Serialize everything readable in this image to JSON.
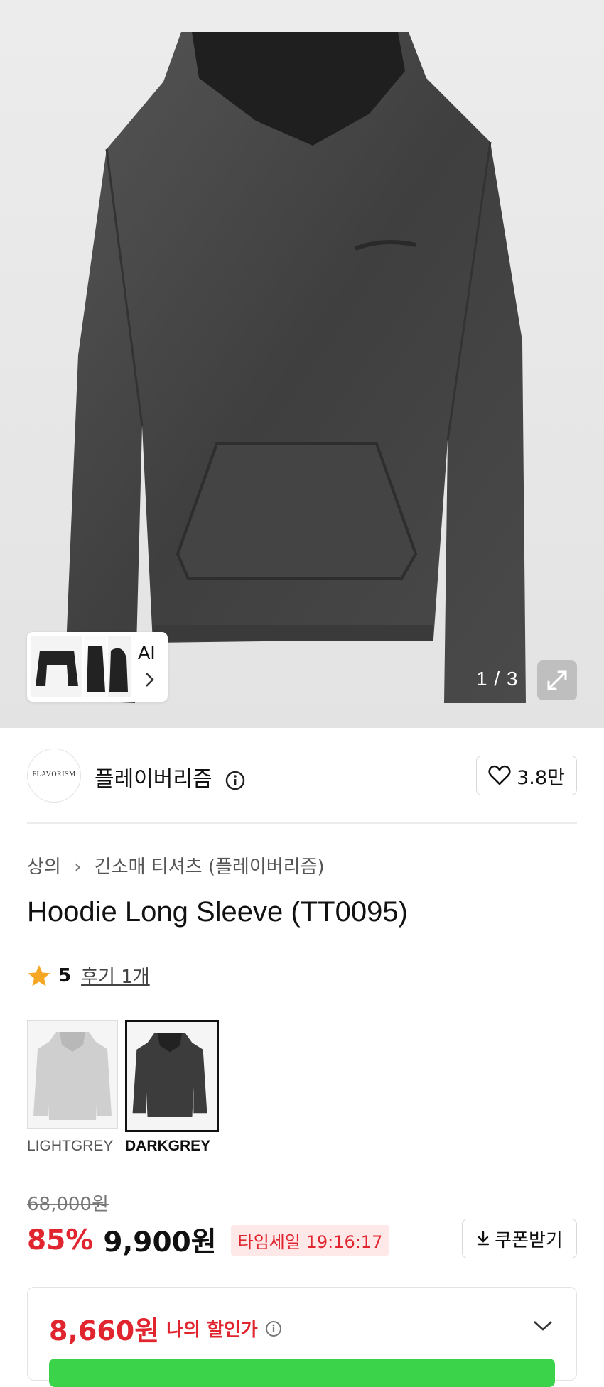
{
  "gallery": {
    "ai_label": "AI",
    "counter": "1 / 3",
    "thumb_icons": [
      "hoodie-front-thumb",
      "hoodie-side-thumb",
      "hoodie-back-thumb"
    ],
    "zoom_icon": "expand-icon"
  },
  "store": {
    "logo_text": "FLAVORISM",
    "name": "플레이버리즘",
    "likes": "3.8만"
  },
  "breadcrumb": {
    "category": "상의",
    "subcategory": "긴소매 티셔츠 (플레이버리즘)"
  },
  "product": {
    "title": "Hoodie Long Sleeve (TT0095)",
    "rating": "5",
    "reviews": "후기 1개"
  },
  "colors": [
    {
      "label": "LIGHTGREY",
      "selected": false,
      "hex": "#cfcfcf"
    },
    {
      "label": "DARKGREY",
      "selected": true,
      "hex": "#3c3c3c"
    }
  ],
  "pricing": {
    "original": "68,000원",
    "discount": "85%",
    "sale_price": "9,900원",
    "timesale": "타임세일 19:16:17",
    "coupon_label": "쿠폰받기",
    "my_price": "8,660원",
    "my_price_label": "나의 할인가"
  },
  "theme": {
    "accent_red": "#e0252f",
    "star": "#f5a623",
    "green": "#3ad34a"
  }
}
